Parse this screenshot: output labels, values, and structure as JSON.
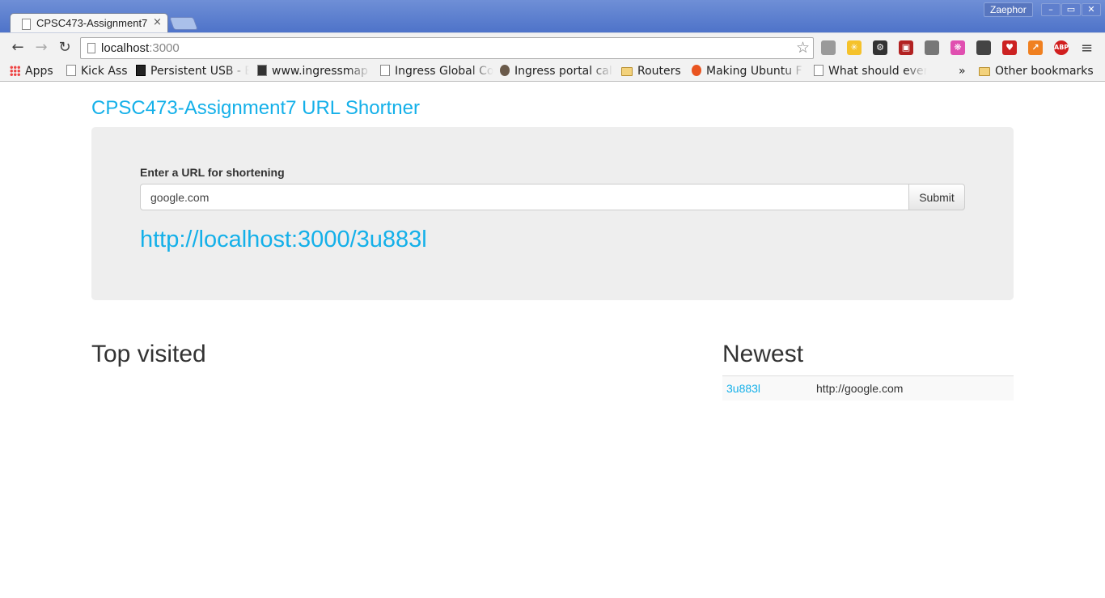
{
  "browser": {
    "tab_title": "CPSC473-Assignment7 URL Shortner",
    "tab_close": "×",
    "profile_name": "Zaephor",
    "window_controls": {
      "minimize": "–",
      "maximize": "▭",
      "close": "✕"
    },
    "address": {
      "host": "localhost",
      "port": ":3000"
    },
    "bookmarks": [
      {
        "label": "Apps",
        "icon": "apps-grid-icon"
      },
      {
        "label": "Kick Ass",
        "icon": "page-icon"
      },
      {
        "label": "Persistent USB - E",
        "icon": "terminal-icon"
      },
      {
        "label": "www.ingressmap",
        "icon": "page-icon"
      },
      {
        "label": "Ingress Global Co",
        "icon": "page-icon"
      },
      {
        "label": "Ingress portal cal",
        "icon": "ingress-icon"
      },
      {
        "label": "Routers",
        "icon": "folder-icon"
      },
      {
        "label": "Making Ubuntu F",
        "icon": "ubuntu-icon"
      },
      {
        "label": "What should ever",
        "icon": "page-icon"
      }
    ],
    "bookmarks_overflow": "»",
    "other_bookmarks": "Other bookmarks",
    "extensions": [
      {
        "name": "comment-icon",
        "color": "#9a9a9a",
        "glyph": ""
      },
      {
        "name": "sparkle-icon",
        "color": "#f5c22b",
        "glyph": "✳"
      },
      {
        "name": "gear-icon",
        "color": "#333333",
        "glyph": "⚙"
      },
      {
        "name": "tape-icon",
        "color": "#b22222",
        "glyph": "▣"
      },
      {
        "name": "cast-icon",
        "color": "#777777",
        "glyph": ""
      },
      {
        "name": "color-wheel-icon",
        "color": "#e04fb0",
        "glyph": "❋"
      },
      {
        "name": "mask-icon",
        "color": "#444444",
        "glyph": ""
      },
      {
        "name": "heart-icon",
        "color": "#cc2222",
        "glyph": "♥"
      },
      {
        "name": "trend-icon",
        "color": "#f08020",
        "glyph": "↗"
      },
      {
        "name": "adblock-icon",
        "color": "#d11f1f",
        "glyph": "ABP"
      }
    ]
  },
  "page": {
    "brand": "CPSC473-Assignment7 URL Shortner",
    "form": {
      "label": "Enter a URL for shortening",
      "input_value": "google.com",
      "submit_label": "Submit"
    },
    "short_url": "http://localhost:3000/3u883l",
    "top_visited_title": "Top visited",
    "newest_title": "Newest",
    "newest": [
      {
        "code": "3u883l",
        "url": "http://google.com"
      }
    ]
  }
}
